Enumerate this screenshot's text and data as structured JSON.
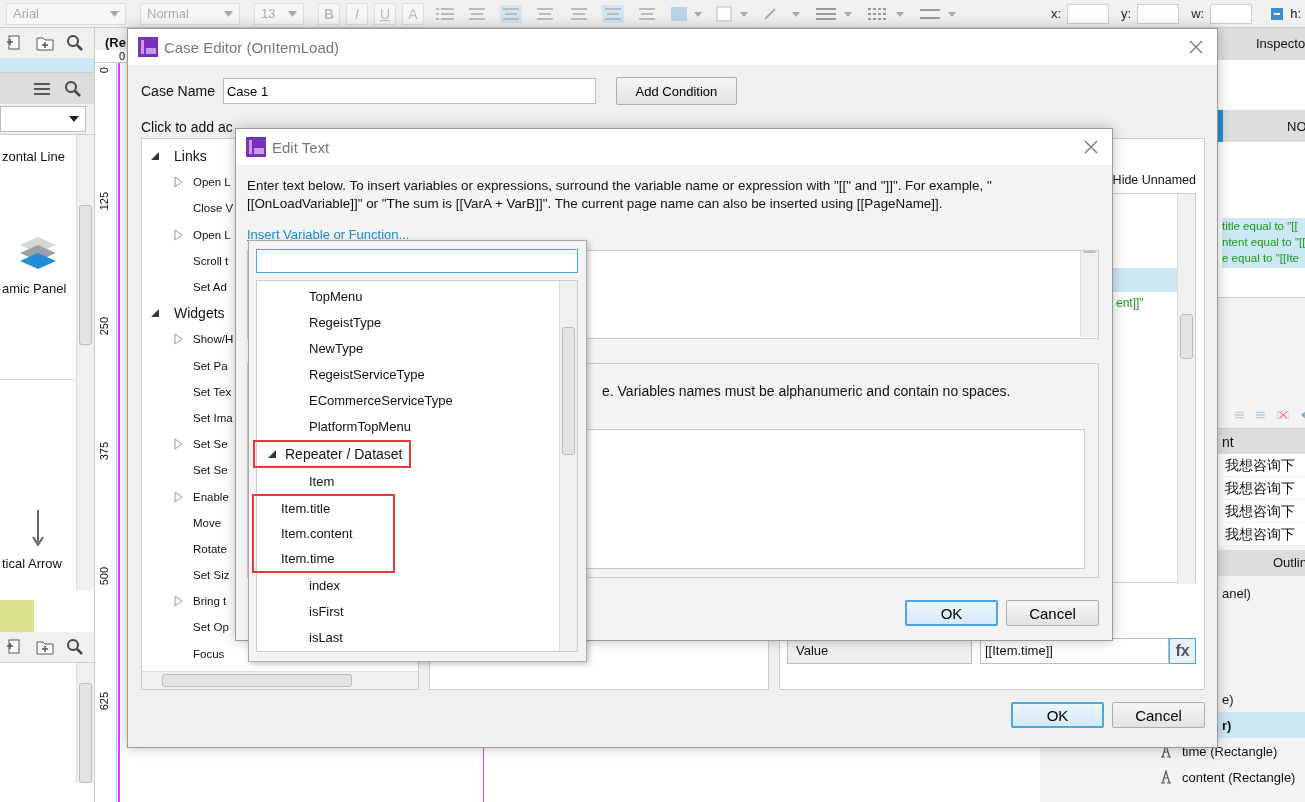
{
  "toolbar": {
    "font": "Arial",
    "style": "Normal",
    "size": "13",
    "bold": "B",
    "italic": "I",
    "underline": "U",
    "text_color": "A",
    "coords": [
      "x:",
      "y:",
      "w:",
      "h:"
    ]
  },
  "left_panel": {
    "widgets": [
      {
        "label": "zontal Line",
        "kind": "plain"
      },
      {
        "label": "amic Panel",
        "kind": "layers"
      },
      {
        "label": "tical Arrow",
        "kind": "arrow"
      }
    ]
  },
  "canvas": {
    "tab": "(Re",
    "top_mark": "0",
    "ruler_marks": [
      "0",
      "125",
      "250",
      "375",
      "500",
      "625"
    ]
  },
  "right_panel": {
    "title": "Inspecto",
    "tab": "NO",
    "interactions": [
      "title equal to \"[[",
      "ntent equal to \"[[",
      "e equal to \"[[Ite"
    ],
    "table_header": "nt",
    "table_rows": [
      "我想咨询下",
      "我想咨询下",
      "我想咨询下",
      "我想咨询下"
    ],
    "outline_title": "Outlin",
    "outline": [
      {
        "label": "anel)",
        "kind": "plain",
        "selected": false
      },
      {
        "label": "e)",
        "kind": "plain",
        "selected": false
      },
      {
        "label": "r)",
        "kind": "plain",
        "selected": true
      },
      {
        "label": "time (Rectangle)",
        "kind": "text",
        "selected": false
      },
      {
        "label": "content (Rectangle)",
        "kind": "text",
        "selected": false
      }
    ]
  },
  "case_editor": {
    "title": "Case Editor (OnItemLoad)",
    "case_name_label": "Case Name",
    "case_name": "Case 1",
    "add_condition": "Add Condition",
    "actions_label": "Click to add ac",
    "actions": [
      {
        "label": "Links",
        "expanded": true,
        "children": [
          {
            "label": "Open L",
            "expandable": true
          },
          {
            "label": "Close V",
            "expandable": false
          },
          {
            "label": "Open L",
            "expandable": true
          },
          {
            "label": "Scroll t",
            "expandable": false
          },
          {
            "label": "Set Ad",
            "expandable": false
          }
        ]
      },
      {
        "label": "Widgets",
        "expanded": true,
        "children": [
          {
            "label": "Show/H",
            "expandable": true
          },
          {
            "label": "Set Pa",
            "expandable": false
          },
          {
            "label": "Set Tex",
            "expandable": false
          },
          {
            "label": "Set Ima",
            "expandable": false
          },
          {
            "label": "Set Se",
            "expandable": true
          },
          {
            "label": "Set Se",
            "expandable": false
          },
          {
            "label": "Enable",
            "expandable": true
          },
          {
            "label": "Move",
            "expandable": false
          },
          {
            "label": "Rotate",
            "expandable": false
          },
          {
            "label": "Set Siz",
            "expandable": false
          },
          {
            "label": "Bring t",
            "expandable": true
          },
          {
            "label": "Set Op",
            "expandable": false
          },
          {
            "label": "Focus",
            "expandable": false
          }
        ]
      }
    ],
    "hide_unnamed": "Hide Unnamed",
    "configured_line": "ent]]\"",
    "value_label": "Value",
    "value": "[[Item.time]]",
    "fx": "fx",
    "ok": "OK",
    "cancel": "Cancel"
  },
  "edit_text": {
    "title": "Edit Text",
    "instructions": "Enter text below. To insert variables or expressions, surround the variable name or expression with \"[[\" and \"]]\". For example, \"[[OnLoadVariable]]\" or \"The sum is [[VarA + VarB]]\". The current page name can also be inserted using [[PageName]].",
    "insert_link": "Insert Variable or Function...",
    "variables_note": "e. Variables names must be alphanumeric and contain no spaces.",
    "ok": "OK",
    "cancel": "Cancel"
  },
  "variable_menu": {
    "items": [
      {
        "label": "TopMenu",
        "kind": "item",
        "marked": false
      },
      {
        "label": "RegeistType",
        "kind": "item",
        "marked": false
      },
      {
        "label": "NewType",
        "kind": "item",
        "marked": false
      },
      {
        "label": "RegeistServiceType",
        "kind": "item",
        "marked": false
      },
      {
        "label": "ECommerceServiceType",
        "kind": "item",
        "marked": false
      },
      {
        "label": "PlatformTopMenu",
        "kind": "item",
        "marked": false
      },
      {
        "label": "Repeater / Dataset",
        "kind": "group",
        "expanded": true,
        "marked": true
      },
      {
        "label": "Item",
        "kind": "item",
        "marked": false
      },
      {
        "label": "Item.title",
        "kind": "item",
        "marked": true
      },
      {
        "label": "Item.content",
        "kind": "item",
        "marked": true
      },
      {
        "label": "Item.time",
        "kind": "item",
        "marked": true
      },
      {
        "label": "index",
        "kind": "item",
        "marked": false
      },
      {
        "label": "isFirst",
        "kind": "item",
        "marked": false
      },
      {
        "label": "isLast",
        "kind": "item",
        "marked": false
      }
    ]
  }
}
